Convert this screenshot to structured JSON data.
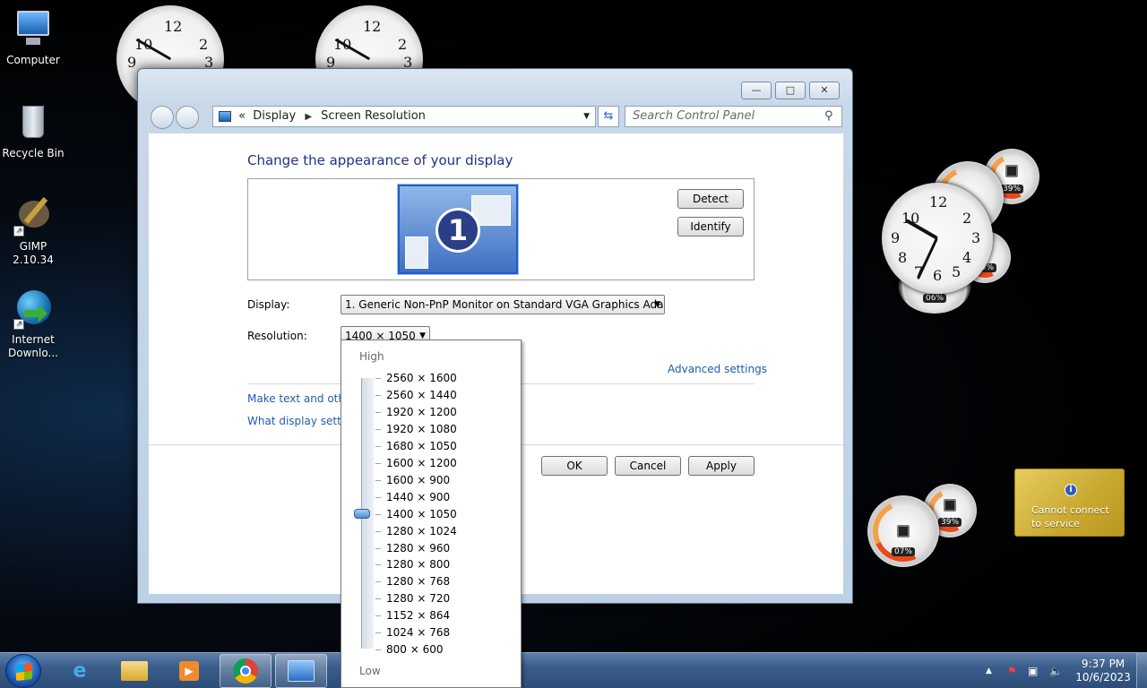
{
  "desktop": {
    "icons": [
      {
        "label": "Computer"
      },
      {
        "label": "Recycle Bin"
      },
      {
        "label": "GIMP 2.10.34"
      },
      {
        "label": "Internet Downlo..."
      }
    ]
  },
  "gadgets": {
    "meters": [
      {
        "pct": "39%"
      },
      {
        "pct": "06%"
      },
      {
        "pct": "39%"
      },
      {
        "pct": "07%"
      }
    ],
    "weather": {
      "message_line1": "Cannot connect",
      "message_line2": "to service",
      "icon": "info-icon"
    }
  },
  "window": {
    "buttons": {
      "minimize": "—",
      "maximize": "□",
      "close": "✕"
    },
    "address": {
      "root_sep": "«",
      "crumb1": "Display",
      "crumb2": "Screen Resolution"
    },
    "search": {
      "placeholder": "Search Control Panel"
    },
    "heading": "Change the appearance of your display",
    "monitor_number": "1",
    "detect_label": "Detect",
    "identify_label": "Identify",
    "display_label": "Display:",
    "display_value": "1. Generic Non-PnP Monitor on Standard VGA Graphics Adapter",
    "resolution_label": "Resolution:",
    "resolution_value": "1400 × 1050",
    "advanced_link": "Advanced settings",
    "link1": "Make text and other",
    "link2": "What display setting",
    "ok_label": "OK",
    "cancel_label": "Cancel",
    "apply_label": "Apply"
  },
  "resolution_popup": {
    "high_label": "High",
    "low_label": "Low",
    "selected": "1400 × 1050",
    "options": [
      "2560 × 1600",
      "2560 × 1440",
      "1920 × 1200",
      "1920 × 1080",
      "1680 × 1050",
      "1600 × 1200",
      "1600 × 900",
      "1440 × 900",
      "1400 × 1050",
      "1280 × 1024",
      "1280 × 960",
      "1280 × 800",
      "1280 × 768",
      "1280 × 720",
      "1152 × 864",
      "1024 × 768",
      "800 × 600"
    ]
  },
  "taskbar": {
    "apps": [
      "internet-explorer-icon",
      "file-explorer-icon",
      "media-player-icon",
      "chrome-icon",
      "control-panel-icon"
    ],
    "time": "9:37 PM",
    "date": "10/6/2023"
  }
}
